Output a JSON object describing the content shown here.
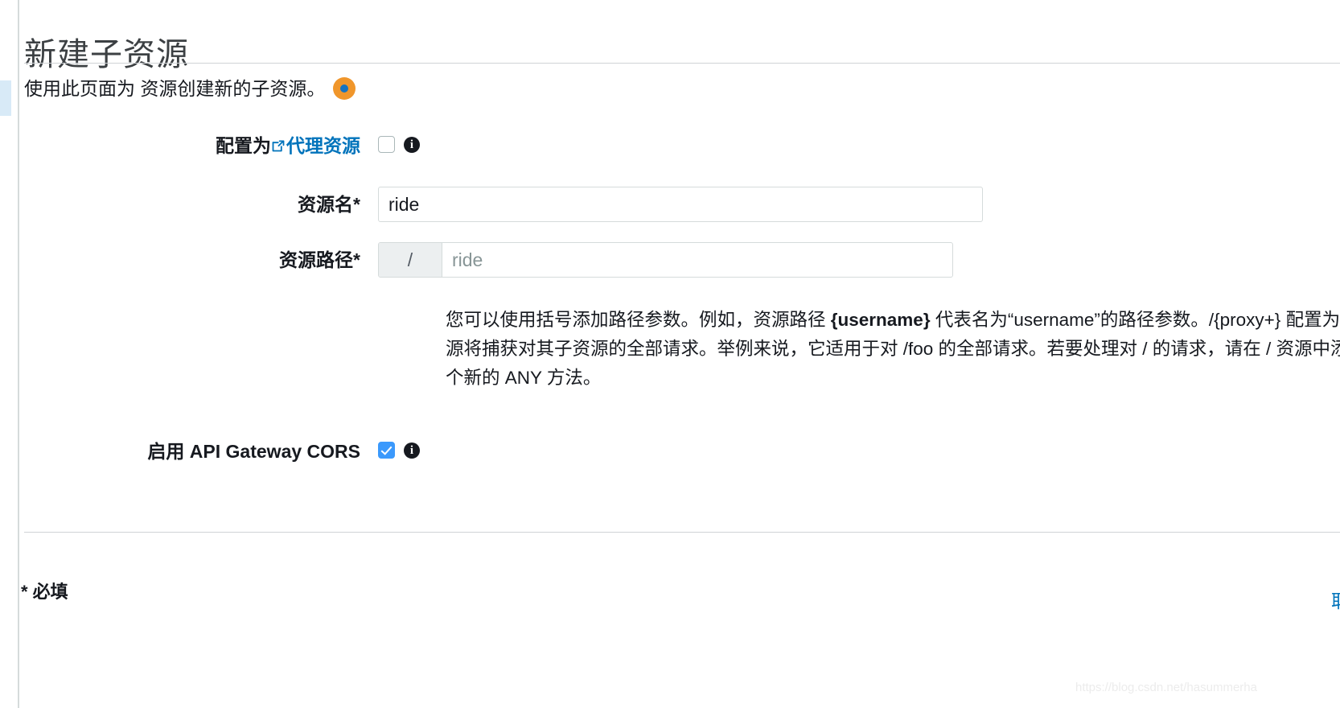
{
  "page": {
    "title": "新建子资源",
    "intro": "使用此页面为 资源创建新的子资源。",
    "pointer_color": "#f0962b",
    "pointer_dot_color": "#1673c0"
  },
  "form": {
    "proxy": {
      "label_prefix": "配置为",
      "link_text": "代理资源",
      "link_color": "#0073bb",
      "checkbox_checked": false,
      "info_icon": "info-icon"
    },
    "resource_name": {
      "label": "资源名*",
      "value": "ride",
      "placeholder": ""
    },
    "resource_path": {
      "label": "资源路径*",
      "prefix": "/",
      "value": "",
      "placeholder": "ride"
    },
    "path_help": {
      "part1": "您可以使用括号添加路径参数。例如，资源路径 ",
      "bold1": "{username}",
      "part2": " 代表名为“username”的路径参数。/{proxy+} 配置为代理资源将捕获对其子资源的全部请求。举例来说，它适用于对 /foo 的全部请求。若要处理对 / 的请求，请在 / 资源中添加一个新的 ANY 方法。"
    },
    "cors": {
      "label": "启用 API Gateway CORS",
      "checkbox_checked": true,
      "checkbox_color": "#3b99fc",
      "info_icon": "info-icon"
    }
  },
  "footer": {
    "required_note": "* 必填",
    "cancel_label": "取消"
  },
  "watermark": "https://blog.csdn.net/hasummerha"
}
